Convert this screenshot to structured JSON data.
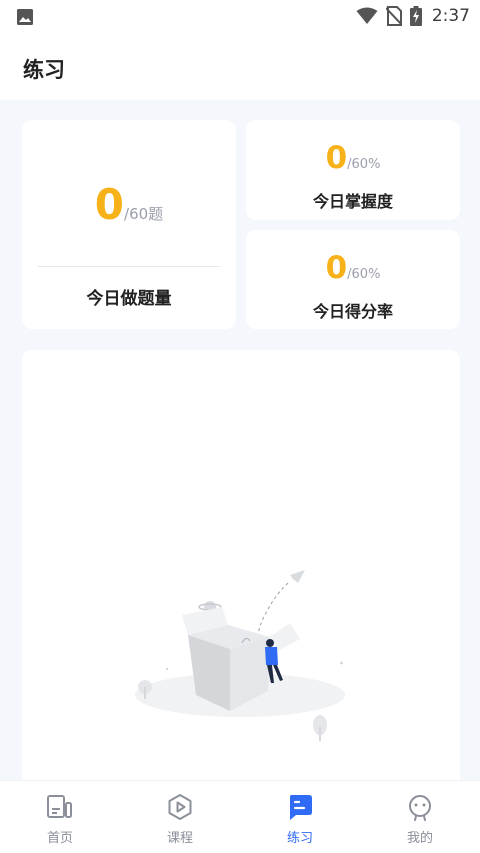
{
  "status_bar": {
    "time": "2:37"
  },
  "header": {
    "title": "练习"
  },
  "stats": {
    "questions": {
      "value": "0",
      "total": "/60题",
      "label": "今日做题量"
    },
    "mastery": {
      "value": "0",
      "total": "/60%",
      "label": "今日掌握度"
    },
    "score": {
      "value": "0",
      "total": "/60%",
      "label": "今日得分率"
    }
  },
  "colors": {
    "accent": "#f7b21a",
    "active_tab": "#2f6bf5",
    "inactive_tab": "#8a8f99"
  },
  "tabbar": {
    "items": [
      {
        "label": "首页",
        "icon": "home-icon"
      },
      {
        "label": "课程",
        "icon": "play-icon"
      },
      {
        "label": "练习",
        "icon": "practice-icon",
        "active": true
      },
      {
        "label": "我的",
        "icon": "profile-icon"
      }
    ]
  }
}
